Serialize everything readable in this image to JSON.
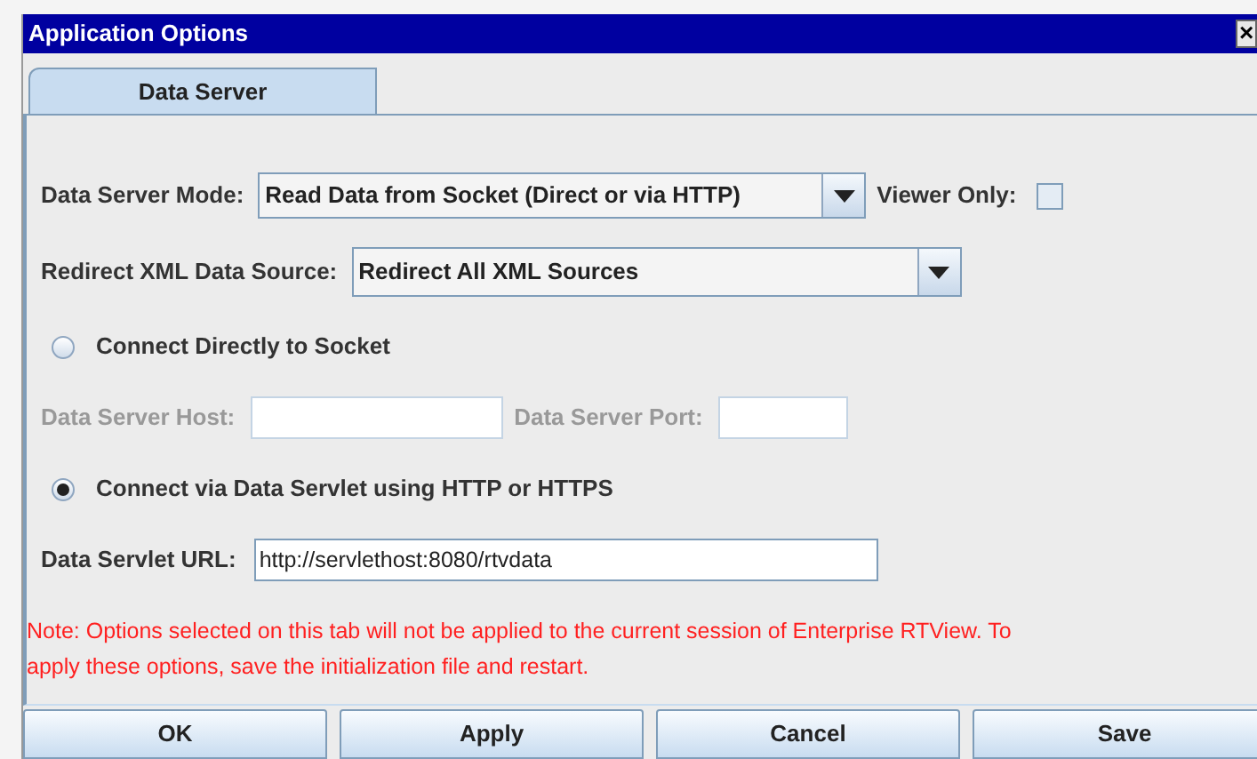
{
  "window": {
    "title": "Application Options",
    "close": "×"
  },
  "tabs": [
    {
      "label": "Data Server",
      "selected": true
    }
  ],
  "mode": {
    "label": "Data Server Mode:",
    "value": "Read Data from Socket (Direct or via HTTP)"
  },
  "viewer_only": {
    "label": "Viewer Only:",
    "checked": false
  },
  "redirect": {
    "label": "Redirect XML Data Source:",
    "value": "Redirect All XML Sources"
  },
  "radios": [
    {
      "label": "Connect Directly to Socket",
      "selected": false
    },
    {
      "label": "Connect via Data Servlet using HTTP or HTTPS",
      "selected": true
    }
  ],
  "host_fields": [
    {
      "label": "Data Server Host:",
      "disabled": true
    },
    {
      "label": "Data Server Port:",
      "disabled": true
    }
  ],
  "servlet_url": {
    "label": "Data Servlet URL:",
    "value": "http://servlethost:8080/rtvdata"
  },
  "note_lines": [
    "Note: Options selected on this tab will not be applied to the current session of Enterprise RTView. To",
    "apply these options, save the initialization file and restart."
  ],
  "buttons": [
    "OK",
    "Apply",
    "Cancel",
    "Save"
  ]
}
